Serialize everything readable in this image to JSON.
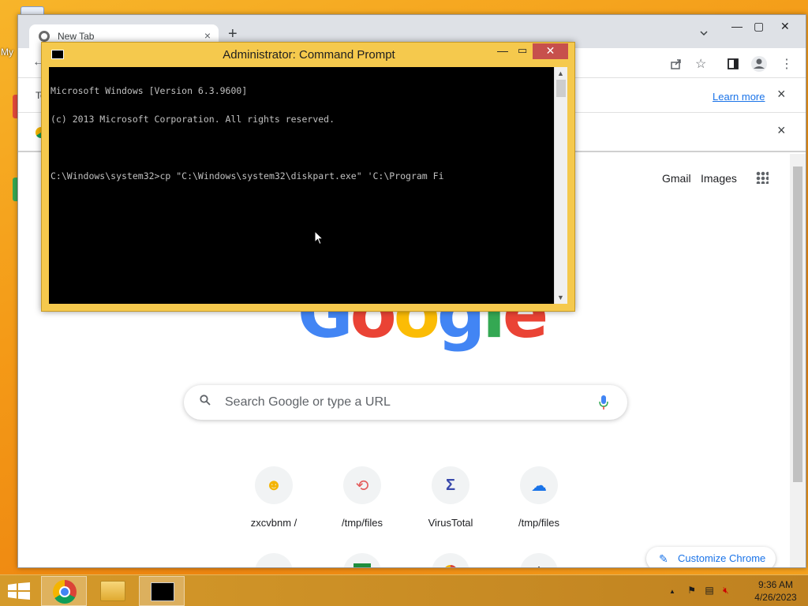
{
  "desktop": {
    "label": "My"
  },
  "browser": {
    "tab_title": "New Tab",
    "tab_close": "×",
    "new_tab": "+",
    "infobar1": {
      "text": "To",
      "learn_more": "Learn more",
      "close": "×"
    },
    "infobar2": {
      "close": "×"
    },
    "ntp": {
      "gmail": "Gmail",
      "images": "Images",
      "logo": [
        "G",
        "o",
        "o",
        "g",
        "l",
        "e"
      ],
      "logo_colors": [
        "#4285f4",
        "#ea4335",
        "#fbbc05",
        "#4285f4",
        "#34a853",
        "#ea4335"
      ],
      "search_placeholder": "Search Google or type a URL",
      "shortcuts": [
        {
          "label": "zxcvbnm /",
          "icon": "smiley-icon"
        },
        {
          "label": "/tmp/files",
          "icon": "files-icon"
        },
        {
          "label": "VirusTotal",
          "icon": "virustotal-icon"
        },
        {
          "label": "/tmp/files",
          "icon": "cloud-upload-icon"
        }
      ],
      "shortcuts_row2": [
        {
          "icon": "smiley-icon"
        },
        {
          "icon": "download-icon"
        },
        {
          "icon": "chrome-icon"
        },
        {
          "icon": "add-shortcut-icon"
        }
      ],
      "customize": "Customize Chrome"
    }
  },
  "cmd": {
    "title": "Administrator:  Command Prompt",
    "lines": [
      "Microsoft Windows [Version 6.3.9600]",
      "(c) 2013 Microsoft Corporation. All rights reserved.",
      "",
      "C:\\Windows\\system32>cp \"C:\\Windows\\system32\\diskpart.exe\" 'C:\\Program Fi"
    ]
  },
  "taskbar": {
    "time": "9:36 AM",
    "date": "4/26/2023",
    "tray_chevron": "▲"
  },
  "colors": {
    "accent": "#1a73e8",
    "taskbar": "#d59a2a",
    "cmd_frame": "#f5c94d"
  }
}
